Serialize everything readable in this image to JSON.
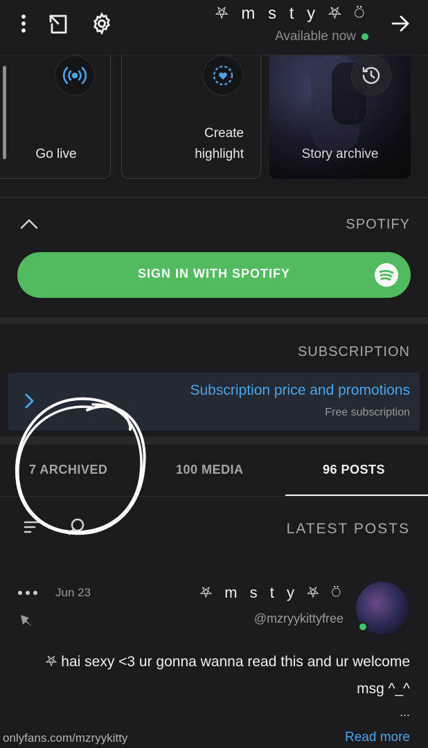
{
  "header": {
    "title": "⛧ m s t y ⛧ ⍥",
    "status": "Available now",
    "icons": [
      "more-vert-icon",
      "share-icon",
      "gear-icon",
      "arrow-right-icon"
    ]
  },
  "highlights": {
    "items": [
      {
        "label": "Go live",
        "icon": "broadcast-icon"
      },
      {
        "label_line1": "Create",
        "label_line2": "highlight",
        "icon": "heart-highlight-icon"
      },
      {
        "label": "Story archive",
        "icon": "clock-history-icon"
      }
    ]
  },
  "spotify": {
    "section_title": "SPOTIFY",
    "button_label": "SIGN IN WITH SPOTIFY"
  },
  "subscription": {
    "section_title": "SUBSCRIPTION",
    "title": "Subscription price and promotions",
    "subtitle": "Free subscription"
  },
  "tabs": [
    {
      "label": "96 POSTS",
      "active": true
    },
    {
      "label": "100 MEDIA",
      "active": false
    },
    {
      "label": "7 ARCHIVED",
      "active": false
    }
  ],
  "latest_posts": {
    "title": "LATEST POSTS"
  },
  "post": {
    "name": "⛧ m s t y ⛧ ⍥",
    "handle": "@mzryykittyfree",
    "date": "Jun 23",
    "text": "⛧ hai sexy <3 ur gonna wanna read this and ur welcome msg ^_^",
    "ellipsis": "...",
    "read_more": "Read more",
    "url": "onlyfans.com/mzryykitty"
  },
  "colors": {
    "background": "#1b1b1d",
    "accent_blue": "#4da3ea",
    "spotify_green": "#52bb5f",
    "online_green": "#3ec46d"
  }
}
